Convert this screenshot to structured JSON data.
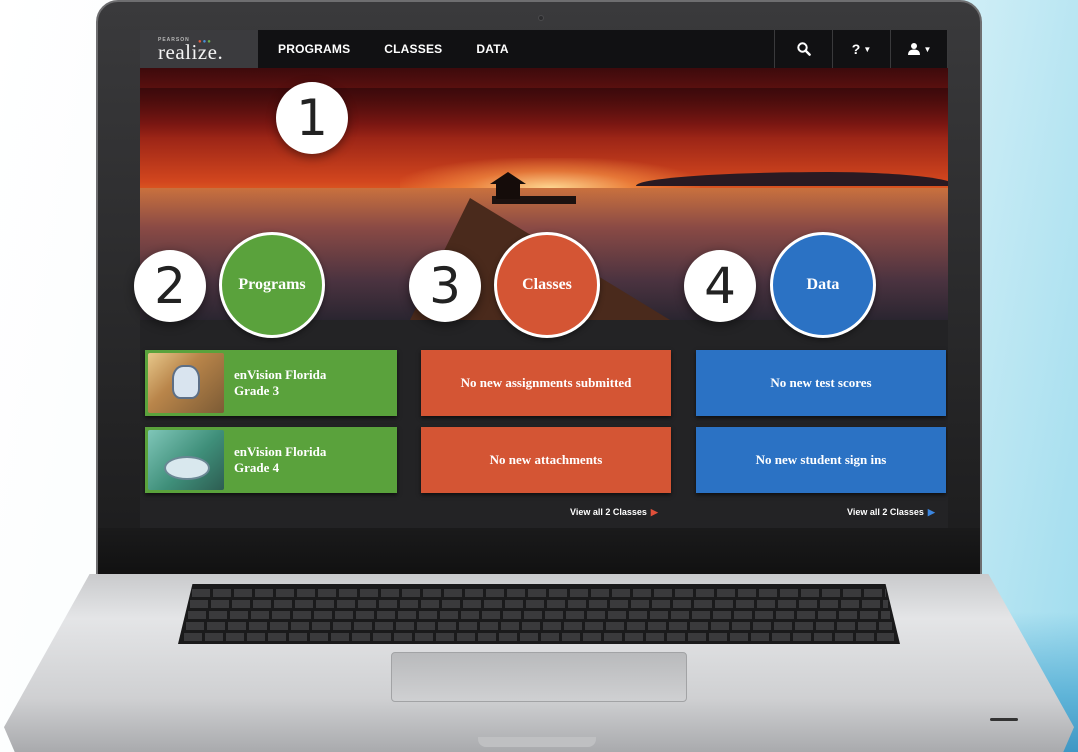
{
  "brand": {
    "company": "PEARSON",
    "product": "realize."
  },
  "nav": {
    "links": [
      {
        "label": "PROGRAMS"
      },
      {
        "label": "CLASSES"
      },
      {
        "label": "DATA"
      }
    ],
    "search_icon": "search-icon",
    "help_label": "?",
    "user_icon": "user-icon"
  },
  "callouts": [
    "1",
    "2",
    "3",
    "4"
  ],
  "categories": {
    "programs": {
      "label": "Programs",
      "color": "#5aa23c"
    },
    "classes": {
      "label": "Classes",
      "color": "#d45534"
    },
    "data": {
      "label": "Data",
      "color": "#2b72c4"
    }
  },
  "programs": [
    {
      "title_line1": "enVision Florida",
      "title_line2": "Grade 3"
    },
    {
      "title_line1": "enVision Florida",
      "title_line2": "Grade 4"
    }
  ],
  "classes_cards": [
    {
      "label": "No new assignments submitted"
    },
    {
      "label": "No new attachments"
    }
  ],
  "data_cards": [
    {
      "label": "No new test scores"
    },
    {
      "label": "No new student sign ins"
    }
  ],
  "classes_view_all": "View all 2 Classes",
  "data_view_all": "View all 2 Classes",
  "colors": {
    "nav_bg": "#111113",
    "brand_bg": "#3b3b3e",
    "green": "#5aa23c",
    "orange": "#d45534",
    "blue": "#2b72c4"
  }
}
